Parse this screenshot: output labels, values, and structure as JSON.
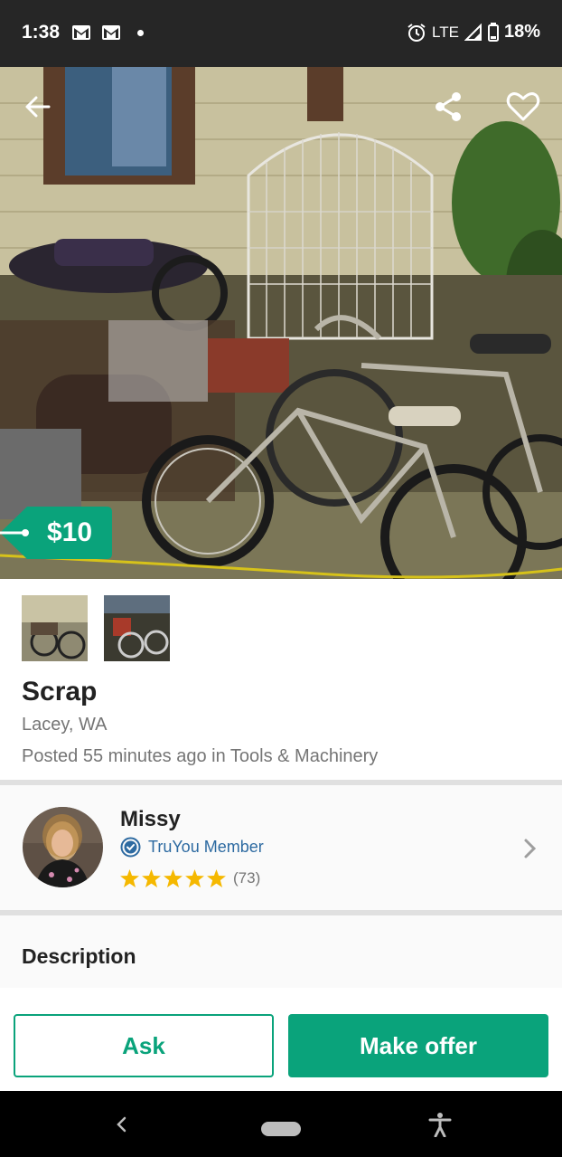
{
  "status_bar": {
    "time": "1:38",
    "network": "LTE",
    "battery": "18%",
    "icons": [
      "gmail-icon",
      "gmail-icon",
      "notification-dot",
      "alarm-icon",
      "signal-icon",
      "battery-icon"
    ]
  },
  "listing": {
    "price": "$10",
    "title": "Scrap",
    "location": "Lacey, WA",
    "posted_prefix": "Posted 55 minutes ago in ",
    "category": "Tools & Machinery",
    "thumbnail_count": 2
  },
  "seller": {
    "name": "Missy",
    "badge": "TruYou Member",
    "rating_stars": 5,
    "rating_count": "(73)"
  },
  "description": {
    "heading": "Description"
  },
  "actions": {
    "ask_label": "Ask",
    "offer_label": "Make offer"
  },
  "colors": {
    "accent": "#0aa37b",
    "badge_blue": "#2d6aa1",
    "star": "#f5b800",
    "status_bar": "#262626"
  }
}
